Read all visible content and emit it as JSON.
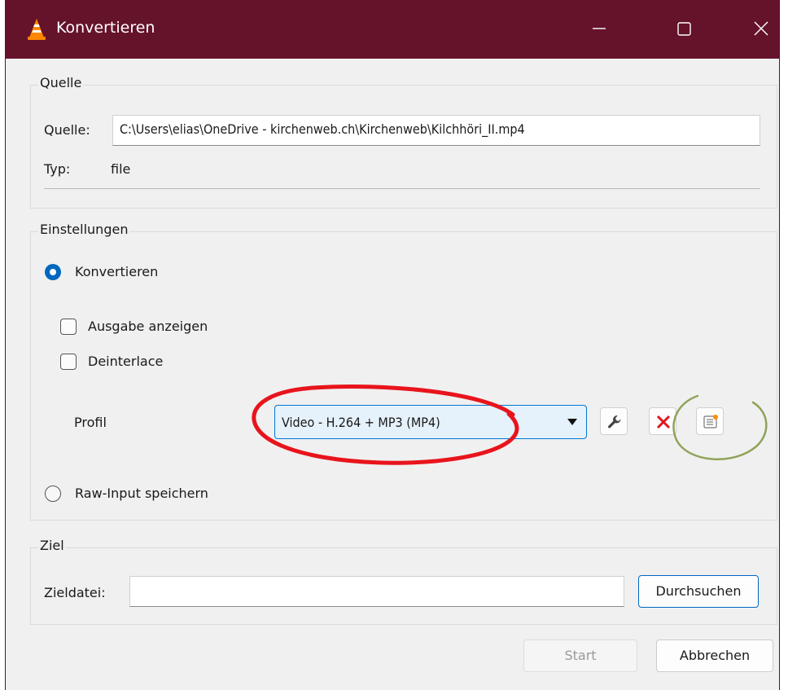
{
  "window": {
    "title": "Konvertieren",
    "icon": "vlc-cone-icon",
    "accent": "#65122b"
  },
  "source": {
    "group_title": "Quelle",
    "source_label": "Quelle:",
    "source_value": "C:\\Users\\elias\\OneDrive - kirchenweb.ch\\Kirchenweb\\Kilchhöri_II.mp4",
    "type_label": "Typ:",
    "type_value": "file"
  },
  "settings": {
    "group_title": "Einstellungen",
    "convert_label": "Konvertieren",
    "convert_selected": true,
    "show_output_label": "Ausgabe anzeigen",
    "show_output_checked": false,
    "deinterlace_label": "Deinterlace",
    "deinterlace_checked": false,
    "profile_label": "Profil",
    "profile_value": "Video - H.264 + MP3 (MP4)",
    "raw_input_label": "Raw-Input speichern",
    "raw_input_selected": false
  },
  "target": {
    "group_title": "Ziel",
    "file_label": "Zieldatei:",
    "file_value": "",
    "browse_label": "Durchsuchen"
  },
  "footer": {
    "start_label": "Start",
    "start_enabled": false,
    "cancel_label": "Abbrechen"
  },
  "annotations": {
    "red_circle_color": "#e8141c",
    "green_circle_color": "#8fa35a"
  }
}
